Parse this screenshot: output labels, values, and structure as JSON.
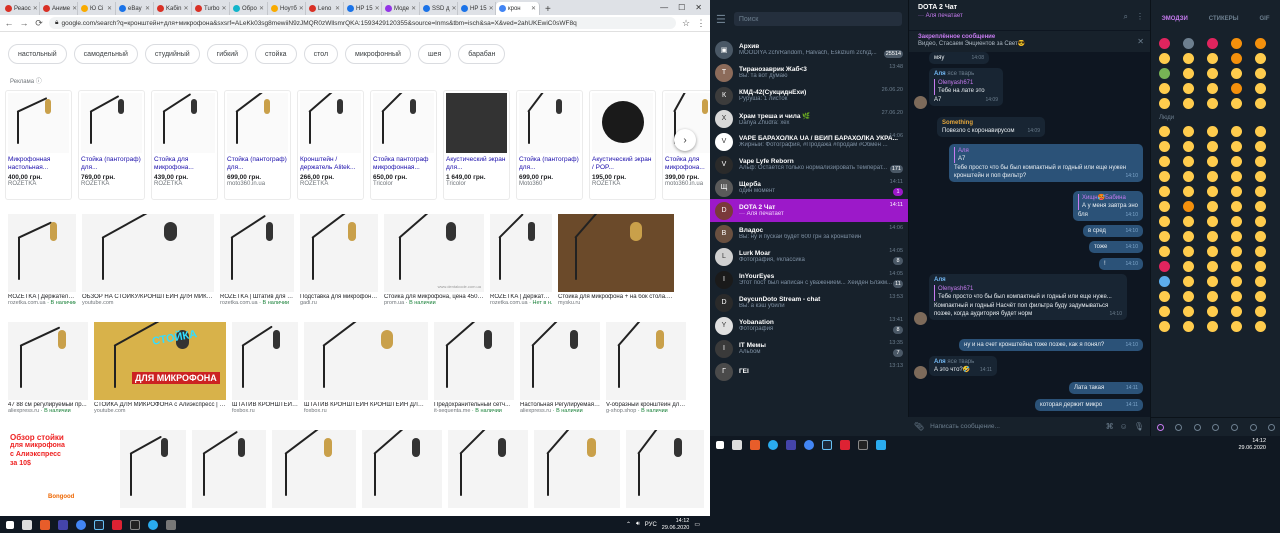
{
  "chrome": {
    "tabs": [
      {
        "label": "Реаос",
        "color": "#d93025"
      },
      {
        "label": "Аниме",
        "color": "#d93025"
      },
      {
        "label": "Ю Ci",
        "color": "#f9ab00"
      },
      {
        "label": "eBay",
        "color": "#1a73e8"
      },
      {
        "label": "Kaбin",
        "color": "#d93025"
      },
      {
        "label": "Turbo",
        "color": "#d93025"
      },
      {
        "label": "Обро",
        "color": "#12b5cb"
      },
      {
        "label": "Ноутб",
        "color": "#f9ab00"
      },
      {
        "label": "Leno",
        "color": "#d93025"
      },
      {
        "label": "HP 15",
        "color": "#1a73e8"
      },
      {
        "label": "Моде",
        "color": "#9334e6"
      },
      {
        "label": "SSD д",
        "color": "#1a73e8"
      },
      {
        "label": "HP 15",
        "color": "#1a73e8"
      },
      {
        "label": "крон",
        "color": "#4285f4"
      }
    ],
    "new_tab": "+",
    "url": "google.com/search?q=кронштейн+для+микрофона&sxsrf=ALeKk03sg8mewiiN9zJMQR0zWllsmrQKA:1593429120355&source=lnms&tbm=isch&sa=X&ved=2ahUKEwiC0sWF8q",
    "chips": [
      "настольный",
      "самодельный",
      "студийный",
      "гибкий",
      "стойка",
      "стол",
      "микрофонный",
      "шея",
      "барабан"
    ],
    "sponsored_label": "Реклама ⓘ",
    "products": [
      {
        "title": "Микрофонная настольная...",
        "price": "400,00 грн.",
        "shop": "ROZETKA"
      },
      {
        "title": "Стойка (пантограф) для...",
        "price": "769,00 грн.",
        "shop": "ROZETKA"
      },
      {
        "title": "Стойка для микрофона...",
        "price": "439,00 грн.",
        "shop": "ROZETKA"
      },
      {
        "title": "Стойка (пантограф) для...",
        "price": "699,00 грн.",
        "shop": "moto360.in.ua"
      },
      {
        "title": "Кронштейн / держатель Alitek...",
        "price": "266,00 грн.",
        "shop": "ROZETKA"
      },
      {
        "title": "Стойка пантограф микрофонная...",
        "price": "650,00 грн.",
        "shop": "Tricolor"
      },
      {
        "title": "Акустический экран для...",
        "price": "1 649,00 грн.",
        "shop": "Tricolor"
      },
      {
        "title": "Стойка (пантограф) для...",
        "price": "699,00 грн.",
        "shop": "Moto360"
      },
      {
        "title": "Акустический экран / POP...",
        "price": "195,00 грн.",
        "shop": "ROZETKA"
      },
      {
        "title": "Стойка для микрофона...",
        "price": "399,00 грн.",
        "shop": "moto360.in.ua"
      }
    ],
    "row1": [
      {
        "cap": "ROZETKA | Держатель ...",
        "src": "rozetka.com.ua",
        "stock": "· В наличии"
      },
      {
        "cap": "ОБЗОР НА СТОЙКУ/КРОНШТЕЙН ДЛЯ МИКРОФ...",
        "src": "youtube.com",
        "stock": ""
      },
      {
        "cap": "ROZETKA | Штатив для м...",
        "src": "rozetka.com.ua",
        "stock": "· В наличии"
      },
      {
        "cap": "Подставка для микрофона...",
        "src": "gadi.ru",
        "stock": ""
      },
      {
        "cap": "Стойка для микрофона, цена 450 грн...",
        "src": "prom.ua",
        "stock": "· В наличии"
      },
      {
        "cap": "ROZETKA | Держател...",
        "src": "rozetka.com.ua",
        "stock": "· Нет в н..."
      },
      {
        "cap": "Стойка для микрофона + на бок стола. В...",
        "src": "mysku.ru",
        "stock": ""
      }
    ],
    "row1_watermark": "www.dentalcode.com.ua",
    "row2": [
      {
        "cap": "47 88 см регулируемый пр...",
        "src": "aliexpress.ru",
        "stock": "· В наличии"
      },
      {
        "cap": "СТОЙКА ДЛЯ МИКРОФОНА с Алиэкспресс | Луч...",
        "src": "youtube.com",
        "stock": ""
      },
      {
        "cap": "ШТАТИВ КРОНШТЕЙН...",
        "src": "foxbox.ru",
        "stock": ""
      },
      {
        "cap": "ШТАТИВ КРОНШТЕЙН КРОНШТЕЙН ДЛЯ М...",
        "src": "foxbox.ru",
        "stock": ""
      },
      {
        "cap": "Предохранительный сетч...",
        "src": "it-sequenta.me",
        "stock": "· В наличии"
      },
      {
        "cap": "Настольная Регулируемая ...",
        "src": "aliexpress.ru",
        "stock": "· В наличии"
      },
      {
        "cap": "V-образный кронштейн для ...",
        "src": "g-shop.shop",
        "stock": "· В наличии"
      }
    ],
    "thumb_overlay": {
      "line1": "СТОЙКА",
      "line2": "ДЛЯ МИКРОФОНА"
    },
    "row3_overlay": {
      "line1": "Обзор стойки",
      "line2": "для микрофона",
      "line3": "с Алиэкспресс",
      "line4": "за 10$"
    },
    "bongood_label": "Bongood",
    "clock": {
      "time": "14:12",
      "date": "29.06.2020",
      "lang": "РУС"
    }
  },
  "telegram": {
    "search_placeholder": "Поиск",
    "chats": [
      {
        "name": "Архив",
        "msg": "MOODIYA 2ch/Random, Halvach, Eskizium 2ch/Д...",
        "time": "",
        "badge": "25514",
        "avatar": "#4a5866",
        "initial": "▣"
      },
      {
        "name": "Тиранозаврик Жаб<3",
        "msg": "Вы: та вот думаю",
        "time": "13:48",
        "badge": "",
        "avatar": "#8c6b5a",
        "initial": "Т"
      },
      {
        "name": "КМД-42(СукциднЕхи)",
        "msg": "Руpуша: 1 листок",
        "time": "26.06.20",
        "badge": "",
        "avatar": "#3c3c3c",
        "initial": "К"
      },
      {
        "name": "Храм треша и чила 🌿",
        "msg": "Danya Zhudra: хех",
        "time": "27.06.20",
        "badge": "",
        "avatar": "#d9d9d9",
        "initial": "Х"
      },
      {
        "name": "VAPE БАРАХОЛКА UA / ВЕЙП БАРАХОЛКА УКРА...",
        "msg": "Жирный: Фотография, #Продажа #продам #Обмен ...",
        "time": "14:06",
        "badge": "",
        "avatar": "#ffffff",
        "initial": "V"
      },
      {
        "name": "Vape Lyfe Reborn",
        "msg": "Альф: Остаётся только нормализировать температ...",
        "time": "",
        "badge": "171",
        "avatar": "#2a2a2a",
        "initial": "V"
      },
      {
        "name": "Щерба",
        "msg": "один момент",
        "time": "14:11",
        "badge": "1",
        "avatar": "#5a5a5a",
        "initial": "Щ"
      },
      {
        "name": "DOTA 2 Чат",
        "msg": "··· Аля печатает",
        "time": "14:11",
        "badge": "",
        "avatar": "#7a3a3a",
        "initial": "D"
      },
      {
        "name": "Владос",
        "msg": "Вы: ну и пускай будет 600 грн за кронштейн",
        "time": "14:06",
        "badge": "",
        "avatar": "#6a5040",
        "initial": "В"
      },
      {
        "name": "Lurk Moar",
        "msg": "Фотография, #классика",
        "time": "14:05",
        "badge": "8",
        "avatar": "#d0d0d0",
        "initial": "L"
      },
      {
        "name": "InYourEyes",
        "msg": "Этот пост был написан с уважением... Хейден Блэкм...",
        "time": "14:05",
        "badge": "11",
        "avatar": "#1a1a1a",
        "initial": "I"
      },
      {
        "name": "DeycunDoto Stream - chat",
        "msg": "Вы: а кэш убили",
        "time": "13:53",
        "badge": "",
        "avatar": "#2a2a2a",
        "initial": "D"
      },
      {
        "name": "Yobanation",
        "msg": "Фотография",
        "time": "13:41",
        "badge": "8",
        "avatar": "#e0e0e0",
        "initial": "Y"
      },
      {
        "name": "IT Мемы",
        "msg": "Альбом",
        "time": "13:35",
        "badge": "7",
        "avatar": "#3a3a3a",
        "initial": "I"
      },
      {
        "name": "ГЕI",
        "msg": "",
        "time": "13:13",
        "badge": "",
        "avatar": "#4a4a4a",
        "initial": "Г"
      }
    ],
    "header": {
      "title": "DOTA 2 Чат",
      "status": "··· Аля печатает"
    },
    "pinned": {
      "title": "Закреплённое сообщение",
      "text": "Видео, Стасаем Энциентов за Свет😎"
    },
    "messages": {
      "m0": {
        "text": "мяу",
        "time": "14:08"
      },
      "m1": {
        "sender": "Аля",
        "via": "ясе тварь",
        "reply": "Olenyash671",
        "reply_text": "Тебе на лате это",
        "text": "A7",
        "time": "14:09"
      },
      "m2": {
        "sender": "Something",
        "text": "Повезло с коронавирусом",
        "time": "14:09"
      },
      "m3": {
        "reply": "Аля",
        "reply_text": "A7",
        "text": "Тебе просто что бы был компактный и годный или еще нужен кронштейн и поп фильтр?",
        "time": "14:10"
      },
      "m4": {
        "reply": "Хищн🥵Бабина",
        "reply_text": "А у меня завтра эно",
        "text": "бля",
        "time": "14:10"
      },
      "m5": {
        "text": "в сред",
        "time": "14:10"
      },
      "m6": {
        "text": "тоже",
        "time": "14:10"
      },
      "m7": {
        "text": "!",
        "time": "14:10"
      },
      "m8": {
        "sender": "Аля",
        "reply": "Olenyash671",
        "reply_text": "Тебе просто что бы был компактный и годный или еще нуже...",
        "text": "Компактный и годный Насчёт поп фильтра буду задумываться позже, когда аудитория будет норм",
        "time": "14:10"
      },
      "m9": {
        "text": "ну и на счет кронштейна тоже позже, как я понял?",
        "time": "14:10"
      },
      "m10": {
        "sender": "Аля",
        "via": "ясе тварь",
        "text": "А это что?🤣",
        "time": "14:11"
      },
      "m11": {
        "text": "Лата такая",
        "time": "14:11"
      },
      "m12": {
        "text": "которая держит микро",
        "time": "14:11"
      }
    },
    "composer_placeholder": "Написать сообщение...",
    "emoji_tabs": [
      "ЭМОДЗИ",
      "СТИКЕРЫ",
      "GIF"
    ],
    "emoji_section": "Люди",
    "emoji_colors_top": [
      "#e0245e",
      "#6d7f8f",
      "#e0245e",
      "#f4900c",
      "#f4900c",
      "#ffcc4d",
      "#ffcc4d",
      "#ffcc4d",
      "#f4900c",
      "#ffcc4d",
      "#77b255",
      "#ffcc4d",
      "#ffcc4d",
      "#ffcc4d",
      "#ffcc4d",
      "#ffcc4d",
      "#ffcc4d",
      "#ffcc4d",
      "#f4900c",
      "#ffcc4d",
      "#ffcc4d",
      "#ffcc4d",
      "#ffcc4d",
      "#ffcc4d",
      "#ffcc4d"
    ],
    "emoji_colors_people": [
      "#ffcc4d",
      "#ffcc4d",
      "#ffcc4d",
      "#ffcc4d",
      "#ffcc4d",
      "#ffcc4d",
      "#ffcc4d",
      "#ffcc4d",
      "#ffcc4d",
      "#ffcc4d",
      "#ffcc4d",
      "#ffcc4d",
      "#ffcc4d",
      "#ffcc4d",
      "#ffcc4d",
      "#ffcc4d",
      "#ffcc4d",
      "#ffcc4d",
      "#ffcc4d",
      "#ffcc4d",
      "#ffcc4d",
      "#ffcc4d",
      "#ffcc4d",
      "#ffcc4d",
      "#ffcc4d",
      "#ffcc4d",
      "#f4900c",
      "#ffcc4d",
      "#ffcc4d",
      "#ffcc4d",
      "#ffcc4d",
      "#ffcc4d",
      "#ffcc4d",
      "#ffcc4d",
      "#ffcc4d",
      "#ffcc4d",
      "#ffcc4d",
      "#ffcc4d",
      "#ffcc4d",
      "#ffcc4d",
      "#ffcc4d",
      "#ffcc4d",
      "#ffcc4d",
      "#ffcc4d",
      "#ffcc4d",
      "#e0245e",
      "#ffcc4d",
      "#ffcc4d",
      "#ffcc4d",
      "#ffcc4d",
      "#5dadec",
      "#ffcc4d",
      "#ffcc4d",
      "#ffcc4d",
      "#ffcc4d",
      "#ffcc4d",
      "#ffcc4d",
      "#ffcc4d",
      "#ffcc4d",
      "#ffcc4d",
      "#ffcc4d",
      "#ffcc4d",
      "#ffcc4d",
      "#ffcc4d",
      "#ffcc4d",
      "#ffcc4d",
      "#ffcc4d",
      "#ffcc4d",
      "#ffcc4d",
      "#ffcc4d"
    ],
    "clock": {
      "time": "14:12",
      "date": "29.06.2020"
    }
  },
  "colors": {
    "accent": "#9c19c9",
    "tg_bg": "#0e1621",
    "tg_panel": "#17212b"
  }
}
